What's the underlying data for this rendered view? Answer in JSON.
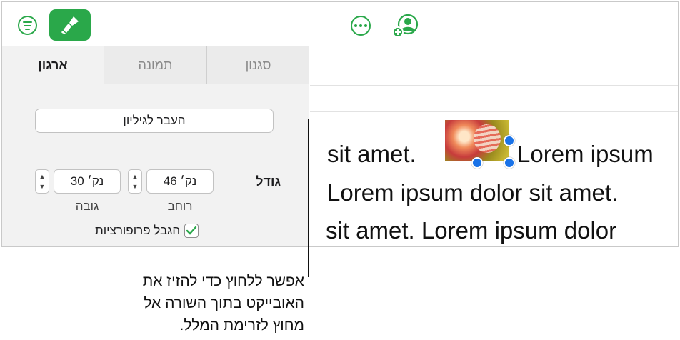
{
  "toolbar": {
    "icons": [
      "list-icon",
      "format-paintbrush-icon",
      "more-icon",
      "collaborate-icon"
    ],
    "accent_color": "#2aa84a"
  },
  "sidebar": {
    "tabs": [
      {
        "label": "סגנון",
        "selected": false
      },
      {
        "label": "תמונה",
        "selected": false
      },
      {
        "label": "ארגון",
        "selected": true
      }
    ],
    "move_button_label": "העבר לגיליון",
    "size": {
      "label": "גודל",
      "width_value": "46 נק׳",
      "width_label": "רוחב",
      "height_value": "30 נק׳",
      "height_label": "גובה"
    },
    "constrain": {
      "label": "הגבל פרופורציות",
      "checked": true
    }
  },
  "document": {
    "line1_start": "sit amet.",
    "line1_end": "Lorem ipsum",
    "line2": "Lorem ipsum dolor sit amet.",
    "line3": "sit amet. Lorem ipsum dolor",
    "selection_color": "#1a73e8"
  },
  "callout": {
    "line1": "אפשר ללחוץ כדי להזיז את",
    "line2": "האובייקט בתוך השורה אל",
    "line3": "מחוץ לזרימת המלל."
  }
}
